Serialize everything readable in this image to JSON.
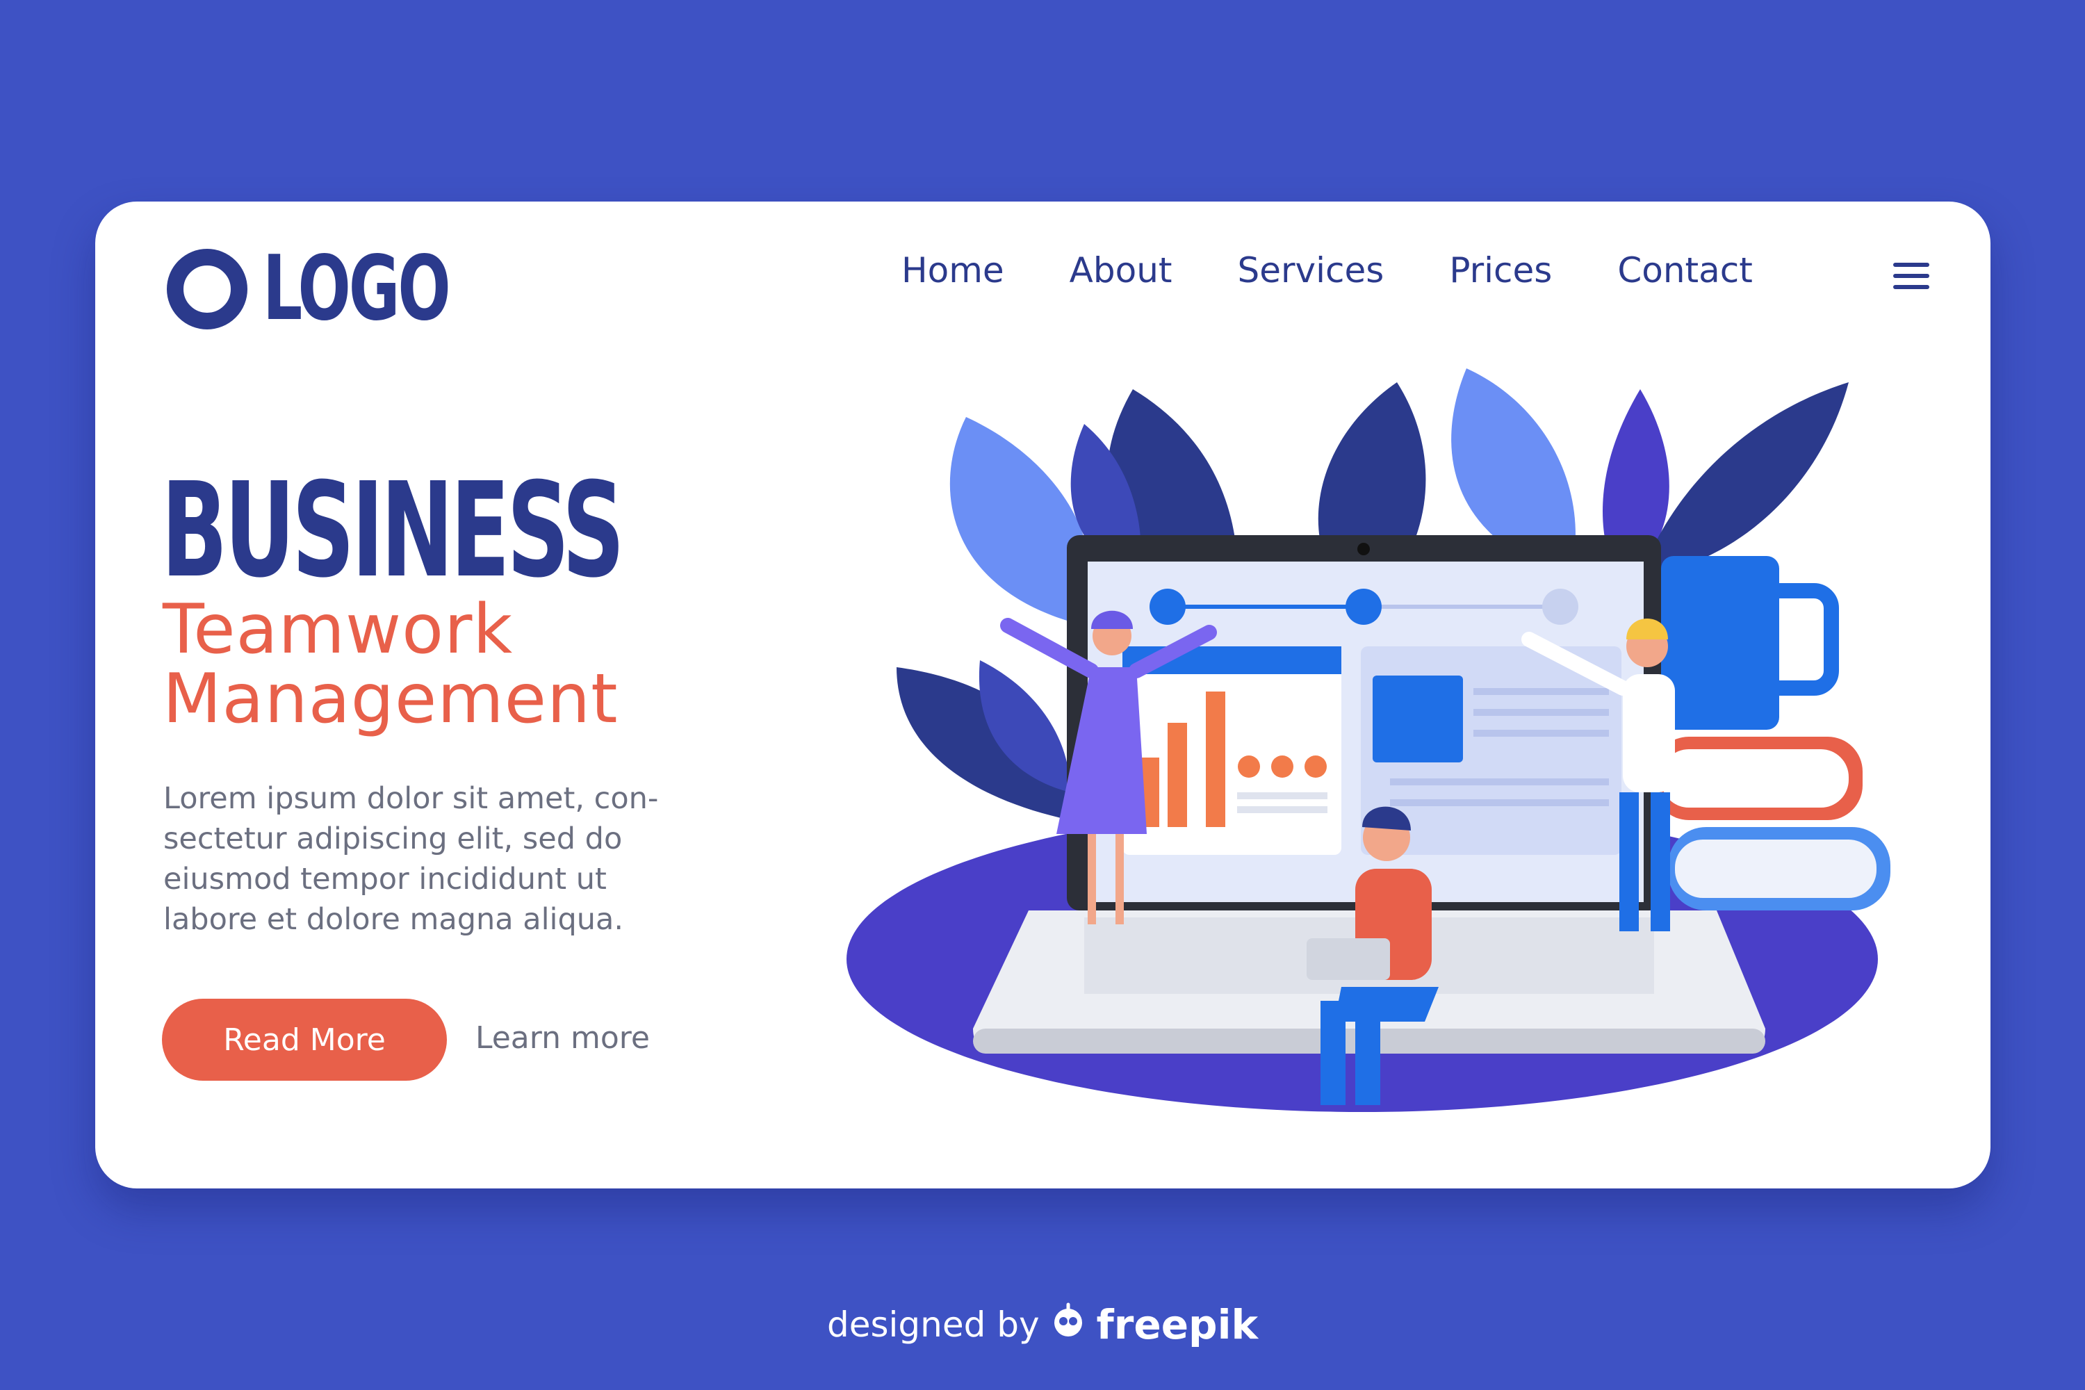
{
  "header": {
    "logo_text": "LOGO",
    "nav": [
      {
        "label": "Home"
      },
      {
        "label": "About"
      },
      {
        "label": "Services"
      },
      {
        "label": "Prices"
      },
      {
        "label": "Contact"
      }
    ],
    "menu_icon": "hamburger-icon"
  },
  "hero": {
    "title": "BUSINESS",
    "subtitle_line1": "Teamwork",
    "subtitle_line2": "Management",
    "body_line1": "Lorem ipsum dolor sit amet, con-",
    "body_line2": "sectetur adipiscing elit, sed do",
    "body_line3": "eiusmod tempor incididunt ut",
    "body_line4": "labore et dolore magna aliqua.",
    "primary_button": "Read More",
    "secondary_link": "Learn more"
  },
  "footer": {
    "prefix": "designed by",
    "brand": "freepik"
  },
  "colors": {
    "background": "#3e52c4",
    "navy": "#2b3a8c",
    "accent": "#e8604a",
    "body_text": "#6b6f80"
  }
}
